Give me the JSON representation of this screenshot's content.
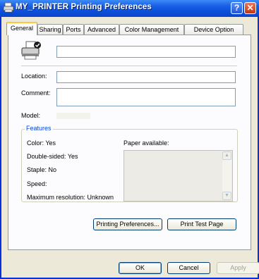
{
  "window": {
    "title": "MY_PRINTER Printing Preferences"
  },
  "title_buttons": {
    "help": "?",
    "close": "✕"
  },
  "tabs": [
    "General",
    "Sharing",
    "Ports",
    "Advanced",
    "Color Management",
    "Device Option"
  ],
  "general": {
    "printer_name": "",
    "location_label": "Location:",
    "location_value": "",
    "comment_label": "Comment:",
    "comment_value": "",
    "model_label": "Model:"
  },
  "features": {
    "title": "Features",
    "color": "Color: Yes",
    "double_sided": "Double-sided: Yes",
    "staple": "Staple: No",
    "speed": "Speed:",
    "max_resolution": "Maximum resolution: Unknown",
    "paper_label": "Paper available:"
  },
  "buttons": {
    "printing_preferences": "Printing Preferences...",
    "print_test_page": "Print Test Page",
    "ok": "OK",
    "cancel": "Cancel",
    "apply": "Apply"
  },
  "icons": {
    "title": "printer-icon",
    "help": "help-icon",
    "close": "close-icon",
    "printer": "printer-icon",
    "scroll_up": "arrow-up-icon",
    "scroll_down": "arrow-down-icon"
  },
  "colors": {
    "titlebar": "#0b4fd9",
    "dialog": "#ece9d8",
    "close": "#c23512",
    "group_title": "#0046d5",
    "active_tab": "#ffc83c"
  }
}
